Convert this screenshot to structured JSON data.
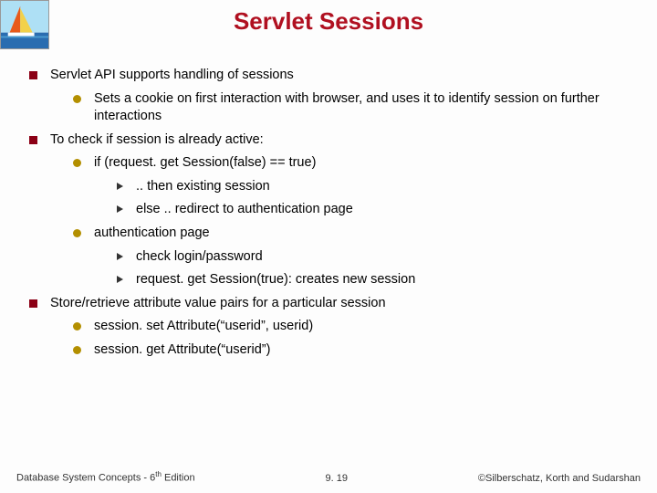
{
  "title": "Servlet Sessions",
  "bullets": {
    "b1": "Servlet API supports handling of sessions",
    "b1a": "Sets a cookie on first interaction with browser, and uses it to identify session on further interactions",
    "b2": "To check if session is already active:",
    "b2a": "if (request. get Session(false) == true)",
    "b2a1": ".. then existing session",
    "b2a2": "else .. redirect to authentication page",
    "b2b": "authentication page",
    "b2b1": "check login/password",
    "b2b2": "request. get Session(true): creates new session",
    "b3": "Store/retrieve attribute value pairs for a particular session",
    "b3a": "session. set Attribute(“userid”, userid)",
    "b3b": "session. get Attribute(“userid”)"
  },
  "footer": {
    "left_prefix": "Database System Concepts - 6",
    "left_sup": "th",
    "left_suffix": " Edition",
    "center": "9. 19",
    "right": "©Silberschatz, Korth and Sudarshan"
  }
}
